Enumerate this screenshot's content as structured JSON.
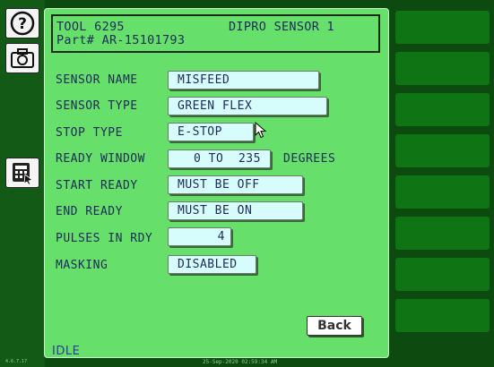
{
  "header": {
    "tool_label": "TOOL 6295",
    "sensor_title": "DIPRO SENSOR 1",
    "part_label": "Part# AR-15101793"
  },
  "fields": [
    {
      "label": "SENSOR NAME",
      "value": "MISFEED"
    },
    {
      "label": "SENSOR TYPE",
      "value": "GREEN FLEX"
    },
    {
      "label": "STOP TYPE",
      "value": "E-STOP"
    },
    {
      "label": "READY WINDOW",
      "value": "0 TO  235",
      "unit": "DEGREES"
    },
    {
      "label": "START READY",
      "value": "MUST BE OFF"
    },
    {
      "label": "END READY",
      "value": "MUST BE ON"
    },
    {
      "label": "PULSES IN RDY",
      "value": "4"
    },
    {
      "label": "MASKING",
      "value": "DISABLED"
    }
  ],
  "buttons": {
    "back": "Back"
  },
  "status": "IDLE",
  "timestamp": "25-Sep-2020 02:59:34 AM",
  "version": "4.6.7.17",
  "icons": [
    "help-icon",
    "camera-icon",
    "keypad-icon"
  ],
  "colors": {
    "panel": "#66e06a",
    "field": "#d7fcfc",
    "background": "#0d4a10",
    "text": "#1c2a5a"
  }
}
